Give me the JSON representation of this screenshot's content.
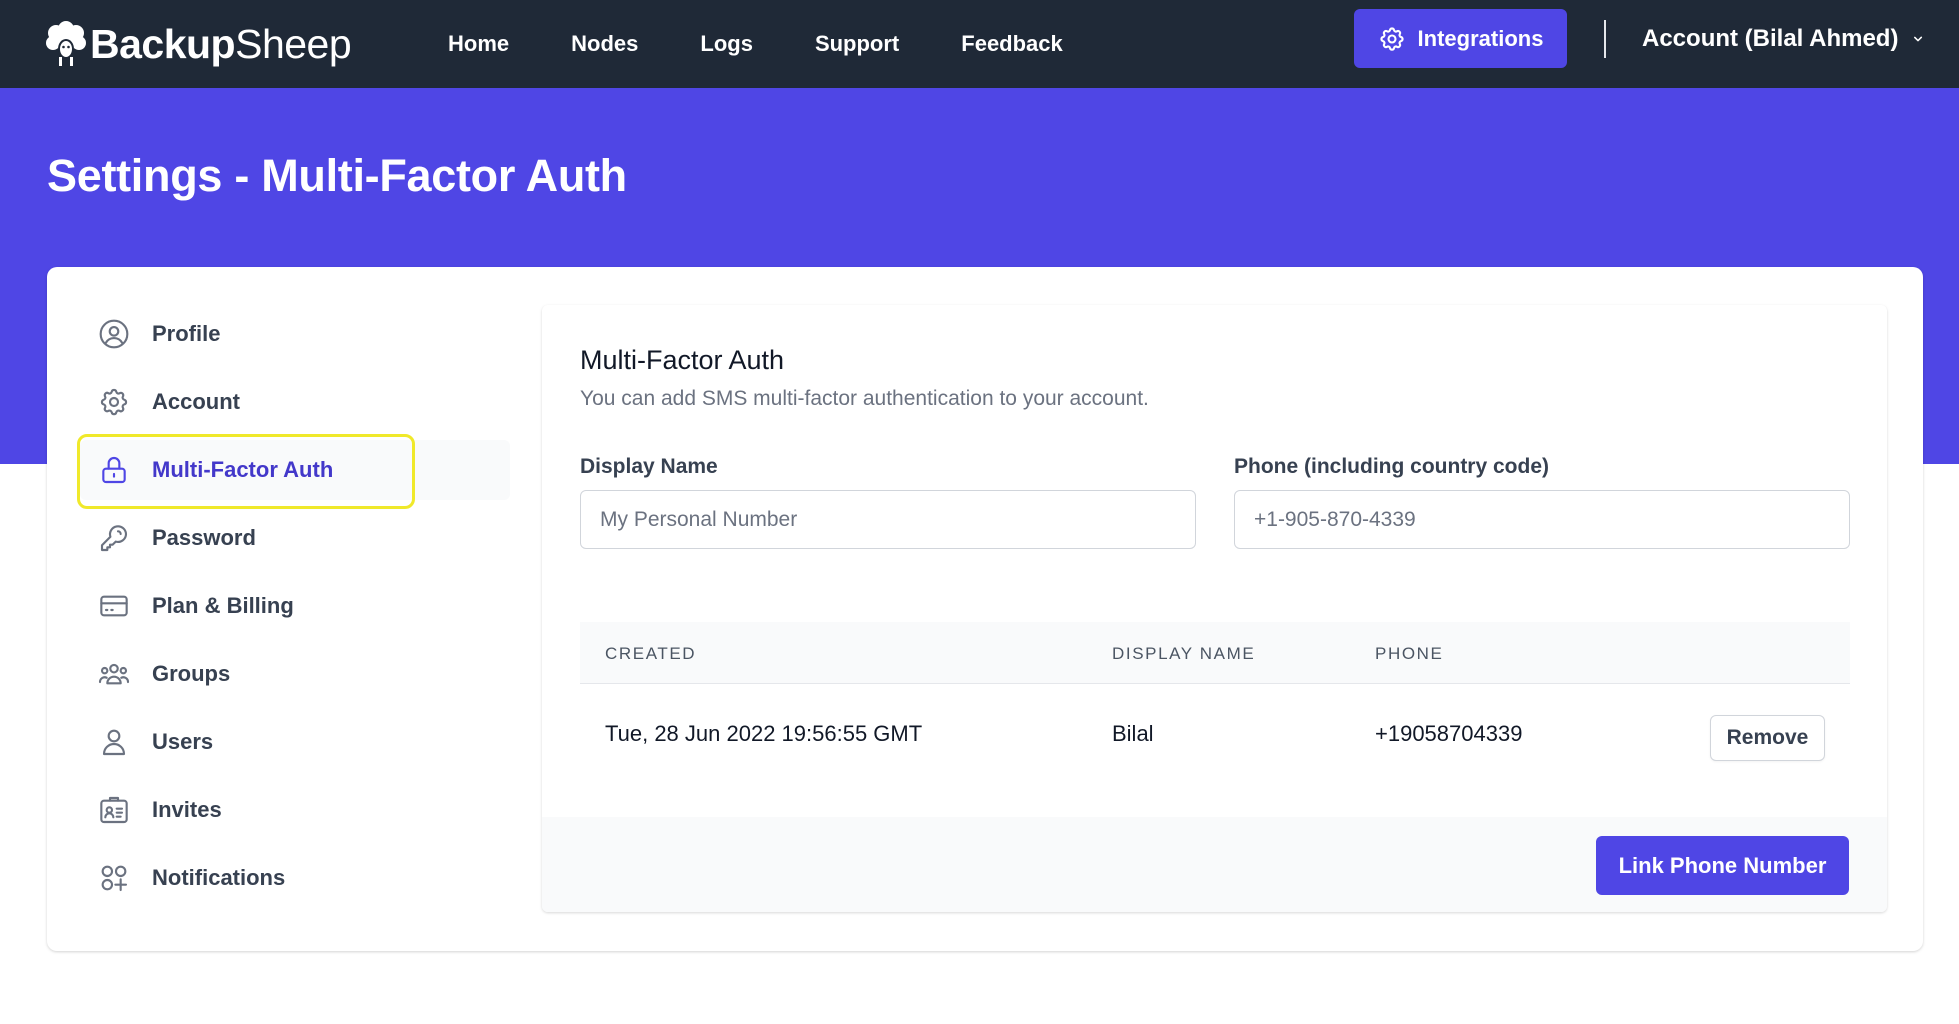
{
  "brand": {
    "name_bold": "Backup",
    "name_light": "Sheep"
  },
  "nav": {
    "links": [
      "Home",
      "Nodes",
      "Logs",
      "Support",
      "Feedback"
    ]
  },
  "integrations": {
    "label": "Integrations"
  },
  "account": {
    "label": "Account (Bilal Ahmed)"
  },
  "page": {
    "title": "Settings - Multi-Factor Auth"
  },
  "sidebar": {
    "items": [
      {
        "label": "Profile",
        "icon": "user-circle-icon"
      },
      {
        "label": "Account",
        "icon": "gear-icon"
      },
      {
        "label": "Multi-Factor Auth",
        "icon": "lock-icon",
        "active": true
      },
      {
        "label": "Password",
        "icon": "key-icon"
      },
      {
        "label": "Plan & Billing",
        "icon": "credit-card-icon"
      },
      {
        "label": "Groups",
        "icon": "user-group-icon"
      },
      {
        "label": "Users",
        "icon": "user-icon"
      },
      {
        "label": "Invites",
        "icon": "id-card-icon"
      },
      {
        "label": "Notifications",
        "icon": "grid-plus-icon"
      }
    ]
  },
  "mfa": {
    "title": "Multi-Factor Auth",
    "description": "You can add SMS multi-factor authentication to your account.",
    "display_name": {
      "label": "Display Name",
      "placeholder": "My Personal Number",
      "value": ""
    },
    "phone": {
      "label": "Phone (including country code)",
      "placeholder": "+1-905-870-4339",
      "value": ""
    },
    "table": {
      "headers": [
        "Created",
        "Display Name",
        "Phone"
      ],
      "rows": [
        {
          "created": "Tue, 28 Jun 2022 19:56:55 GMT",
          "display_name": "Bilal",
          "phone": "+19058704339",
          "action": "Remove"
        }
      ]
    },
    "submit_label": "Link Phone Number"
  },
  "colors": {
    "nav_bg": "#1f2937",
    "accent": "#4f46e5",
    "highlight": "#f0e92a"
  }
}
